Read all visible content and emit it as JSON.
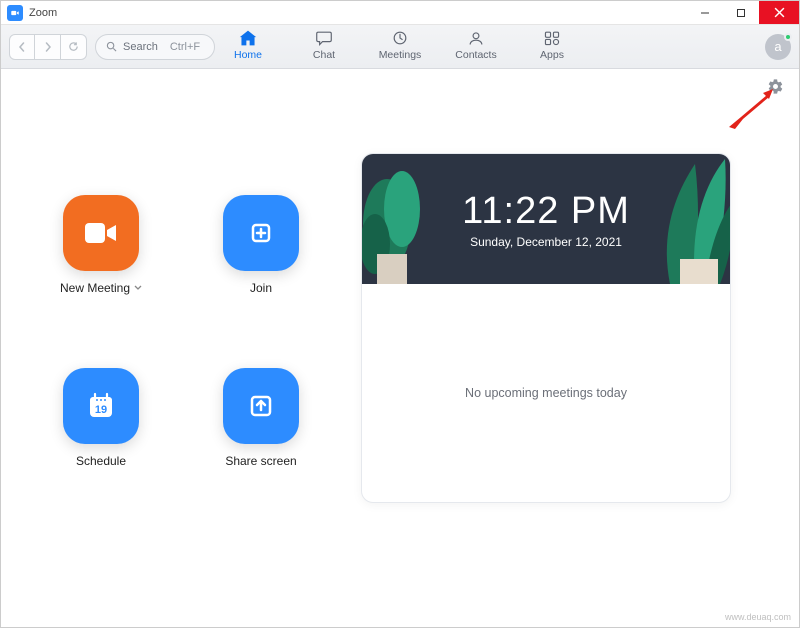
{
  "titlebar": {
    "app_name": "Zoom"
  },
  "toolbar": {
    "search_placeholder": "Search",
    "search_shortcut": "Ctrl+F",
    "tabs": [
      {
        "label": "Home"
      },
      {
        "label": "Chat"
      },
      {
        "label": "Meetings"
      },
      {
        "label": "Contacts"
      },
      {
        "label": "Apps"
      }
    ],
    "avatar_initial": "a"
  },
  "actions": {
    "new_meeting": "New Meeting",
    "join": "Join",
    "schedule": "Schedule",
    "schedule_day": "19",
    "share_screen": "Share screen"
  },
  "clock": {
    "time": "11:22 PM",
    "date": "Sunday, December 12, 2021"
  },
  "meetings": {
    "empty_text": "No upcoming meetings today"
  },
  "watermark": "www.deuaq.com"
}
